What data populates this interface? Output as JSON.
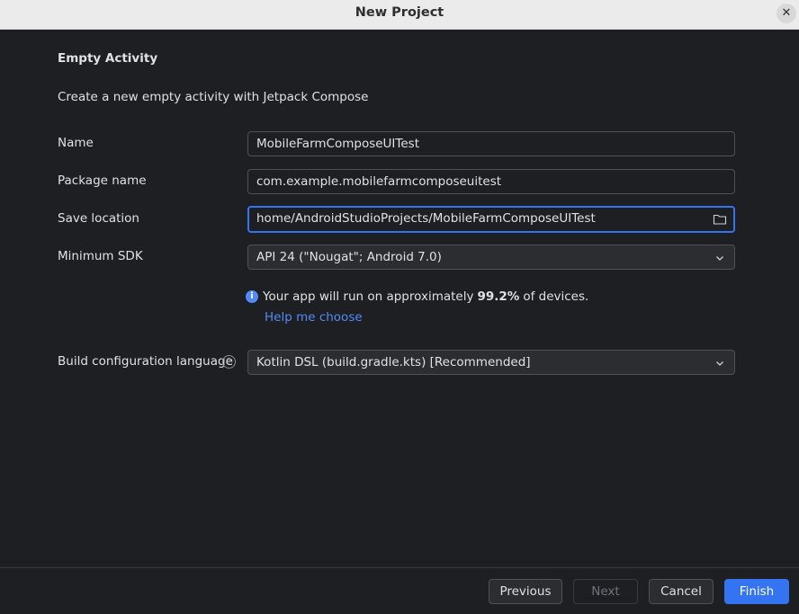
{
  "window": {
    "title": "New Project",
    "close_icon": "close-icon"
  },
  "main": {
    "heading": "Empty Activity",
    "description": "Create a new empty activity with Jetpack Compose",
    "fields": {
      "name": {
        "label": "Name",
        "value": "MobileFarmComposeUITest"
      },
      "package": {
        "label": "Package name",
        "value": "com.example.mobilefarmcomposeuitest"
      },
      "save_location": {
        "label": "Save location",
        "value": "home/AndroidStudioProjects/MobileFarmComposeUITest",
        "icon": "folder-icon"
      },
      "min_sdk": {
        "label": "Minimum SDK",
        "value": "API 24 (\"Nougat\"; Android 7.0)",
        "icon": "chevron-down-icon"
      },
      "build_config": {
        "label": "Build configuration language",
        "value": "Kotlin DSL (build.gradle.kts) [Recommended]",
        "icon": "chevron-down-icon"
      }
    },
    "info": {
      "icon": "info-icon",
      "prefix": "Your app will run on approximately",
      "percent": "99.2%",
      "suffix": "of devices.",
      "help_link": "Help me choose"
    }
  },
  "footer": {
    "previous": "Previous",
    "next": "Next",
    "cancel": "Cancel",
    "finish": "Finish"
  },
  "colors": {
    "accent": "#3574f0",
    "link": "#548af7",
    "background": "#1e1f22",
    "titlebar": "#ebebeb"
  }
}
